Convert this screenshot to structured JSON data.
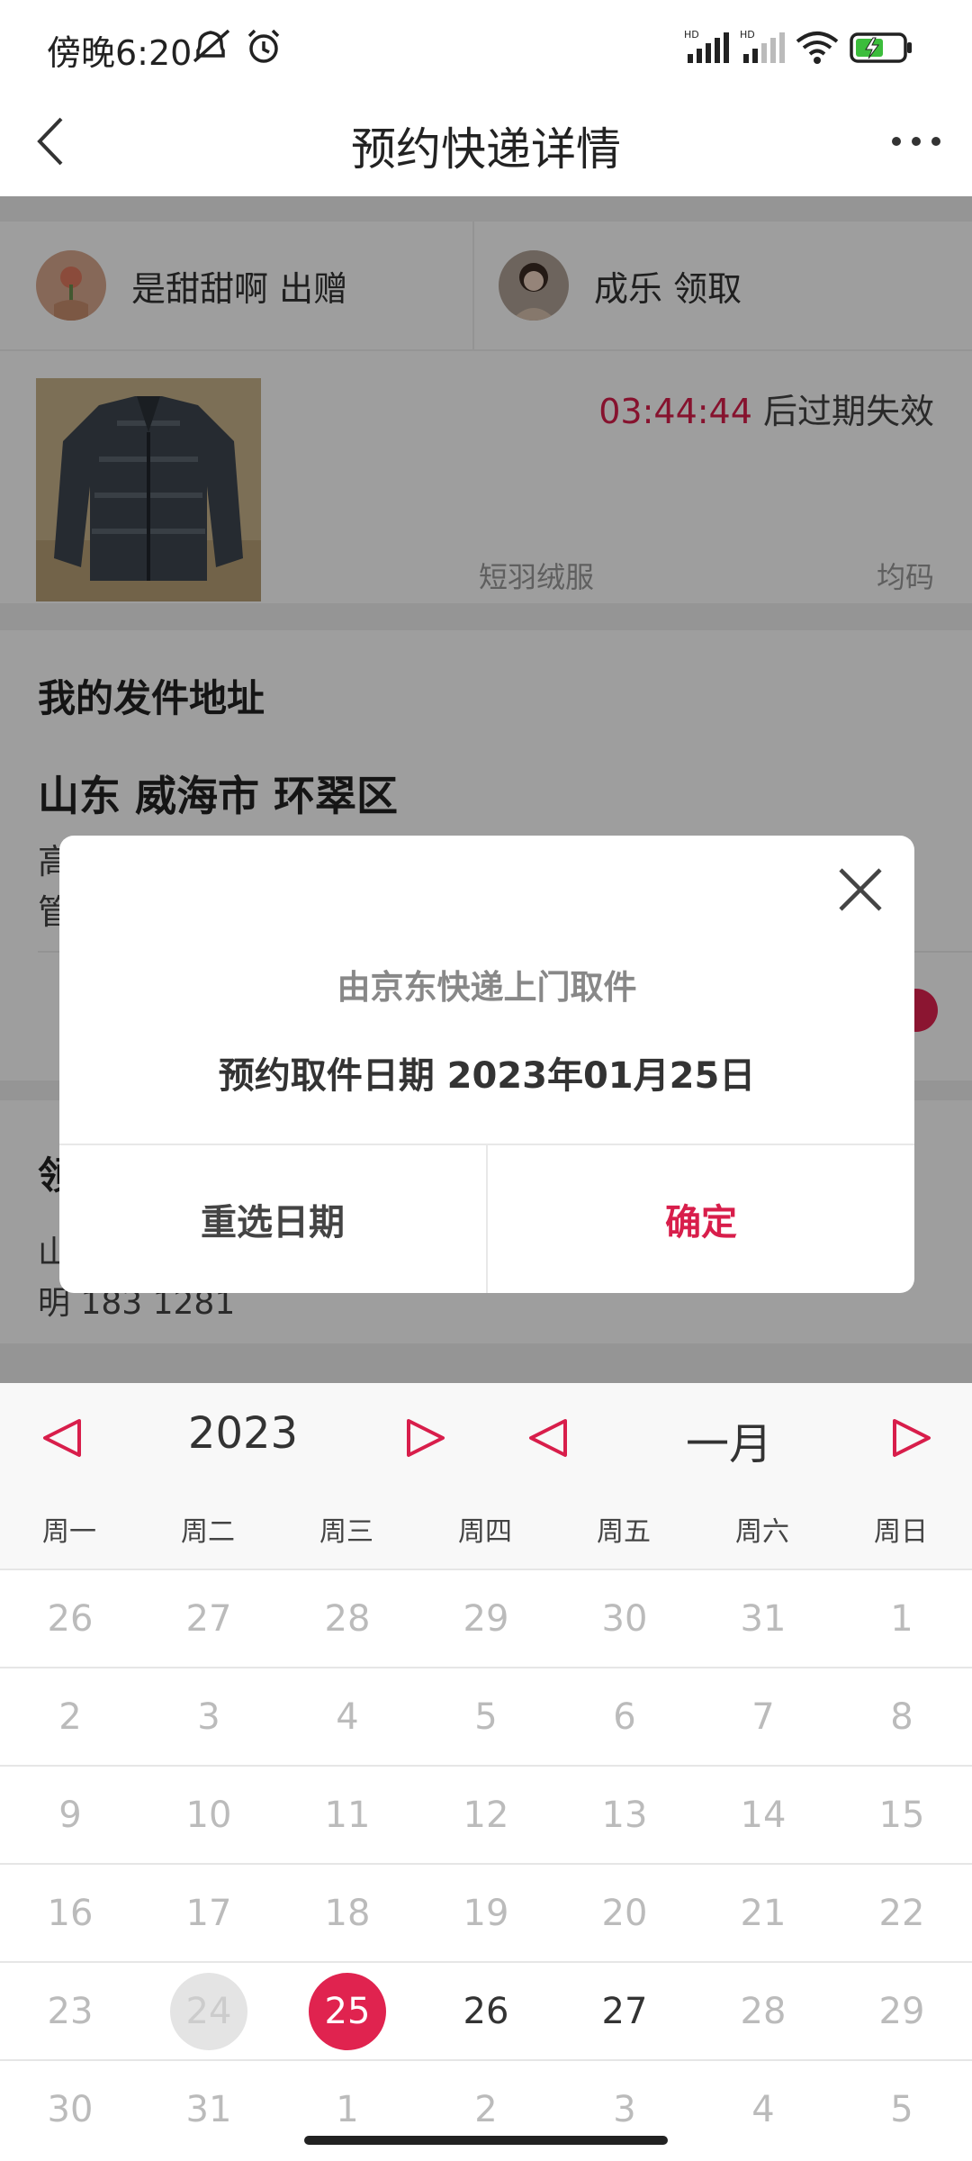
{
  "status_bar": {
    "time": "傍晚6:20",
    "network_labels": [
      "HD",
      "HD"
    ]
  },
  "header": {
    "title": "预约快递详情"
  },
  "users": {
    "giver": {
      "name": "是甜甜啊 出赠"
    },
    "receiver": {
      "name": "成乐 领取"
    }
  },
  "product": {
    "countdown": "03:44:44",
    "expire_suffix": " 后过期失效",
    "category": "短羽绒服",
    "size": "均码"
  },
  "sender_address": {
    "heading": "我的发件地址",
    "region": "山东 威海市 环翠区",
    "line1_start": "高",
    "line2_start": "管"
  },
  "receiver_address": {
    "heading_start": "领",
    "line1_start": "山",
    "line2": "明  183        1281"
  },
  "dialog": {
    "subtitle": "由京东快递上门取件",
    "date_text": "预约取件日期 2023年01月25日",
    "reselect_label": "重选日期",
    "confirm_label": "确定"
  },
  "calendar": {
    "year": "2023",
    "month": "一月",
    "weekdays": [
      "周一",
      "周二",
      "周三",
      "周四",
      "周五",
      "周六",
      "周日"
    ],
    "weeks": [
      [
        "26",
        "27",
        "28",
        "29",
        "30",
        "31",
        "1"
      ],
      [
        "2",
        "3",
        "4",
        "5",
        "6",
        "7",
        "8"
      ],
      [
        "9",
        "10",
        "11",
        "12",
        "13",
        "14",
        "15"
      ],
      [
        "16",
        "17",
        "18",
        "19",
        "20",
        "21",
        "22"
      ],
      [
        "23",
        "24",
        "25",
        "26",
        "27",
        "28",
        "29"
      ],
      [
        "30",
        "31",
        "1",
        "2",
        "3",
        "4",
        "5"
      ]
    ],
    "today": "24",
    "selected": "25",
    "available": [
      "25",
      "26",
      "27"
    ]
  },
  "colors": {
    "accent": "#d81e4b",
    "selected_fill": "#e0234f"
  }
}
